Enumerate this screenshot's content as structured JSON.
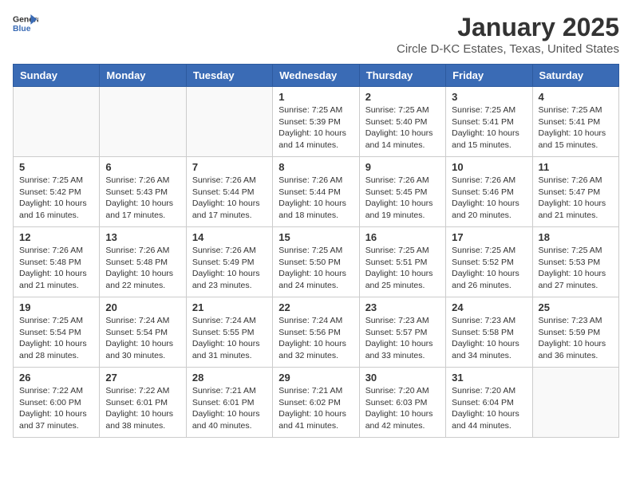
{
  "header": {
    "logo_line1": "General",
    "logo_line2": "Blue",
    "month": "January 2025",
    "location": "Circle D-KC Estates, Texas, United States"
  },
  "days": [
    "Sunday",
    "Monday",
    "Tuesday",
    "Wednesday",
    "Thursday",
    "Friday",
    "Saturday"
  ],
  "weeks": [
    [
      {
        "date": "",
        "info": ""
      },
      {
        "date": "",
        "info": ""
      },
      {
        "date": "",
        "info": ""
      },
      {
        "date": "1",
        "info": "Sunrise: 7:25 AM\nSunset: 5:39 PM\nDaylight: 10 hours\nand 14 minutes."
      },
      {
        "date": "2",
        "info": "Sunrise: 7:25 AM\nSunset: 5:40 PM\nDaylight: 10 hours\nand 14 minutes."
      },
      {
        "date": "3",
        "info": "Sunrise: 7:25 AM\nSunset: 5:41 PM\nDaylight: 10 hours\nand 15 minutes."
      },
      {
        "date": "4",
        "info": "Sunrise: 7:25 AM\nSunset: 5:41 PM\nDaylight: 10 hours\nand 15 minutes."
      }
    ],
    [
      {
        "date": "5",
        "info": "Sunrise: 7:25 AM\nSunset: 5:42 PM\nDaylight: 10 hours\nand 16 minutes."
      },
      {
        "date": "6",
        "info": "Sunrise: 7:26 AM\nSunset: 5:43 PM\nDaylight: 10 hours\nand 17 minutes."
      },
      {
        "date": "7",
        "info": "Sunrise: 7:26 AM\nSunset: 5:44 PM\nDaylight: 10 hours\nand 17 minutes."
      },
      {
        "date": "8",
        "info": "Sunrise: 7:26 AM\nSunset: 5:44 PM\nDaylight: 10 hours\nand 18 minutes."
      },
      {
        "date": "9",
        "info": "Sunrise: 7:26 AM\nSunset: 5:45 PM\nDaylight: 10 hours\nand 19 minutes."
      },
      {
        "date": "10",
        "info": "Sunrise: 7:26 AM\nSunset: 5:46 PM\nDaylight: 10 hours\nand 20 minutes."
      },
      {
        "date": "11",
        "info": "Sunrise: 7:26 AM\nSunset: 5:47 PM\nDaylight: 10 hours\nand 21 minutes."
      }
    ],
    [
      {
        "date": "12",
        "info": "Sunrise: 7:26 AM\nSunset: 5:48 PM\nDaylight: 10 hours\nand 21 minutes."
      },
      {
        "date": "13",
        "info": "Sunrise: 7:26 AM\nSunset: 5:48 PM\nDaylight: 10 hours\nand 22 minutes."
      },
      {
        "date": "14",
        "info": "Sunrise: 7:26 AM\nSunset: 5:49 PM\nDaylight: 10 hours\nand 23 minutes."
      },
      {
        "date": "15",
        "info": "Sunrise: 7:25 AM\nSunset: 5:50 PM\nDaylight: 10 hours\nand 24 minutes."
      },
      {
        "date": "16",
        "info": "Sunrise: 7:25 AM\nSunset: 5:51 PM\nDaylight: 10 hours\nand 25 minutes."
      },
      {
        "date": "17",
        "info": "Sunrise: 7:25 AM\nSunset: 5:52 PM\nDaylight: 10 hours\nand 26 minutes."
      },
      {
        "date": "18",
        "info": "Sunrise: 7:25 AM\nSunset: 5:53 PM\nDaylight: 10 hours\nand 27 minutes."
      }
    ],
    [
      {
        "date": "19",
        "info": "Sunrise: 7:25 AM\nSunset: 5:54 PM\nDaylight: 10 hours\nand 28 minutes."
      },
      {
        "date": "20",
        "info": "Sunrise: 7:24 AM\nSunset: 5:54 PM\nDaylight: 10 hours\nand 30 minutes."
      },
      {
        "date": "21",
        "info": "Sunrise: 7:24 AM\nSunset: 5:55 PM\nDaylight: 10 hours\nand 31 minutes."
      },
      {
        "date": "22",
        "info": "Sunrise: 7:24 AM\nSunset: 5:56 PM\nDaylight: 10 hours\nand 32 minutes."
      },
      {
        "date": "23",
        "info": "Sunrise: 7:23 AM\nSunset: 5:57 PM\nDaylight: 10 hours\nand 33 minutes."
      },
      {
        "date": "24",
        "info": "Sunrise: 7:23 AM\nSunset: 5:58 PM\nDaylight: 10 hours\nand 34 minutes."
      },
      {
        "date": "25",
        "info": "Sunrise: 7:23 AM\nSunset: 5:59 PM\nDaylight: 10 hours\nand 36 minutes."
      }
    ],
    [
      {
        "date": "26",
        "info": "Sunrise: 7:22 AM\nSunset: 6:00 PM\nDaylight: 10 hours\nand 37 minutes."
      },
      {
        "date": "27",
        "info": "Sunrise: 7:22 AM\nSunset: 6:01 PM\nDaylight: 10 hours\nand 38 minutes."
      },
      {
        "date": "28",
        "info": "Sunrise: 7:21 AM\nSunset: 6:01 PM\nDaylight: 10 hours\nand 40 minutes."
      },
      {
        "date": "29",
        "info": "Sunrise: 7:21 AM\nSunset: 6:02 PM\nDaylight: 10 hours\nand 41 minutes."
      },
      {
        "date": "30",
        "info": "Sunrise: 7:20 AM\nSunset: 6:03 PM\nDaylight: 10 hours\nand 42 minutes."
      },
      {
        "date": "31",
        "info": "Sunrise: 7:20 AM\nSunset: 6:04 PM\nDaylight: 10 hours\nand 44 minutes."
      },
      {
        "date": "",
        "info": ""
      }
    ]
  ]
}
